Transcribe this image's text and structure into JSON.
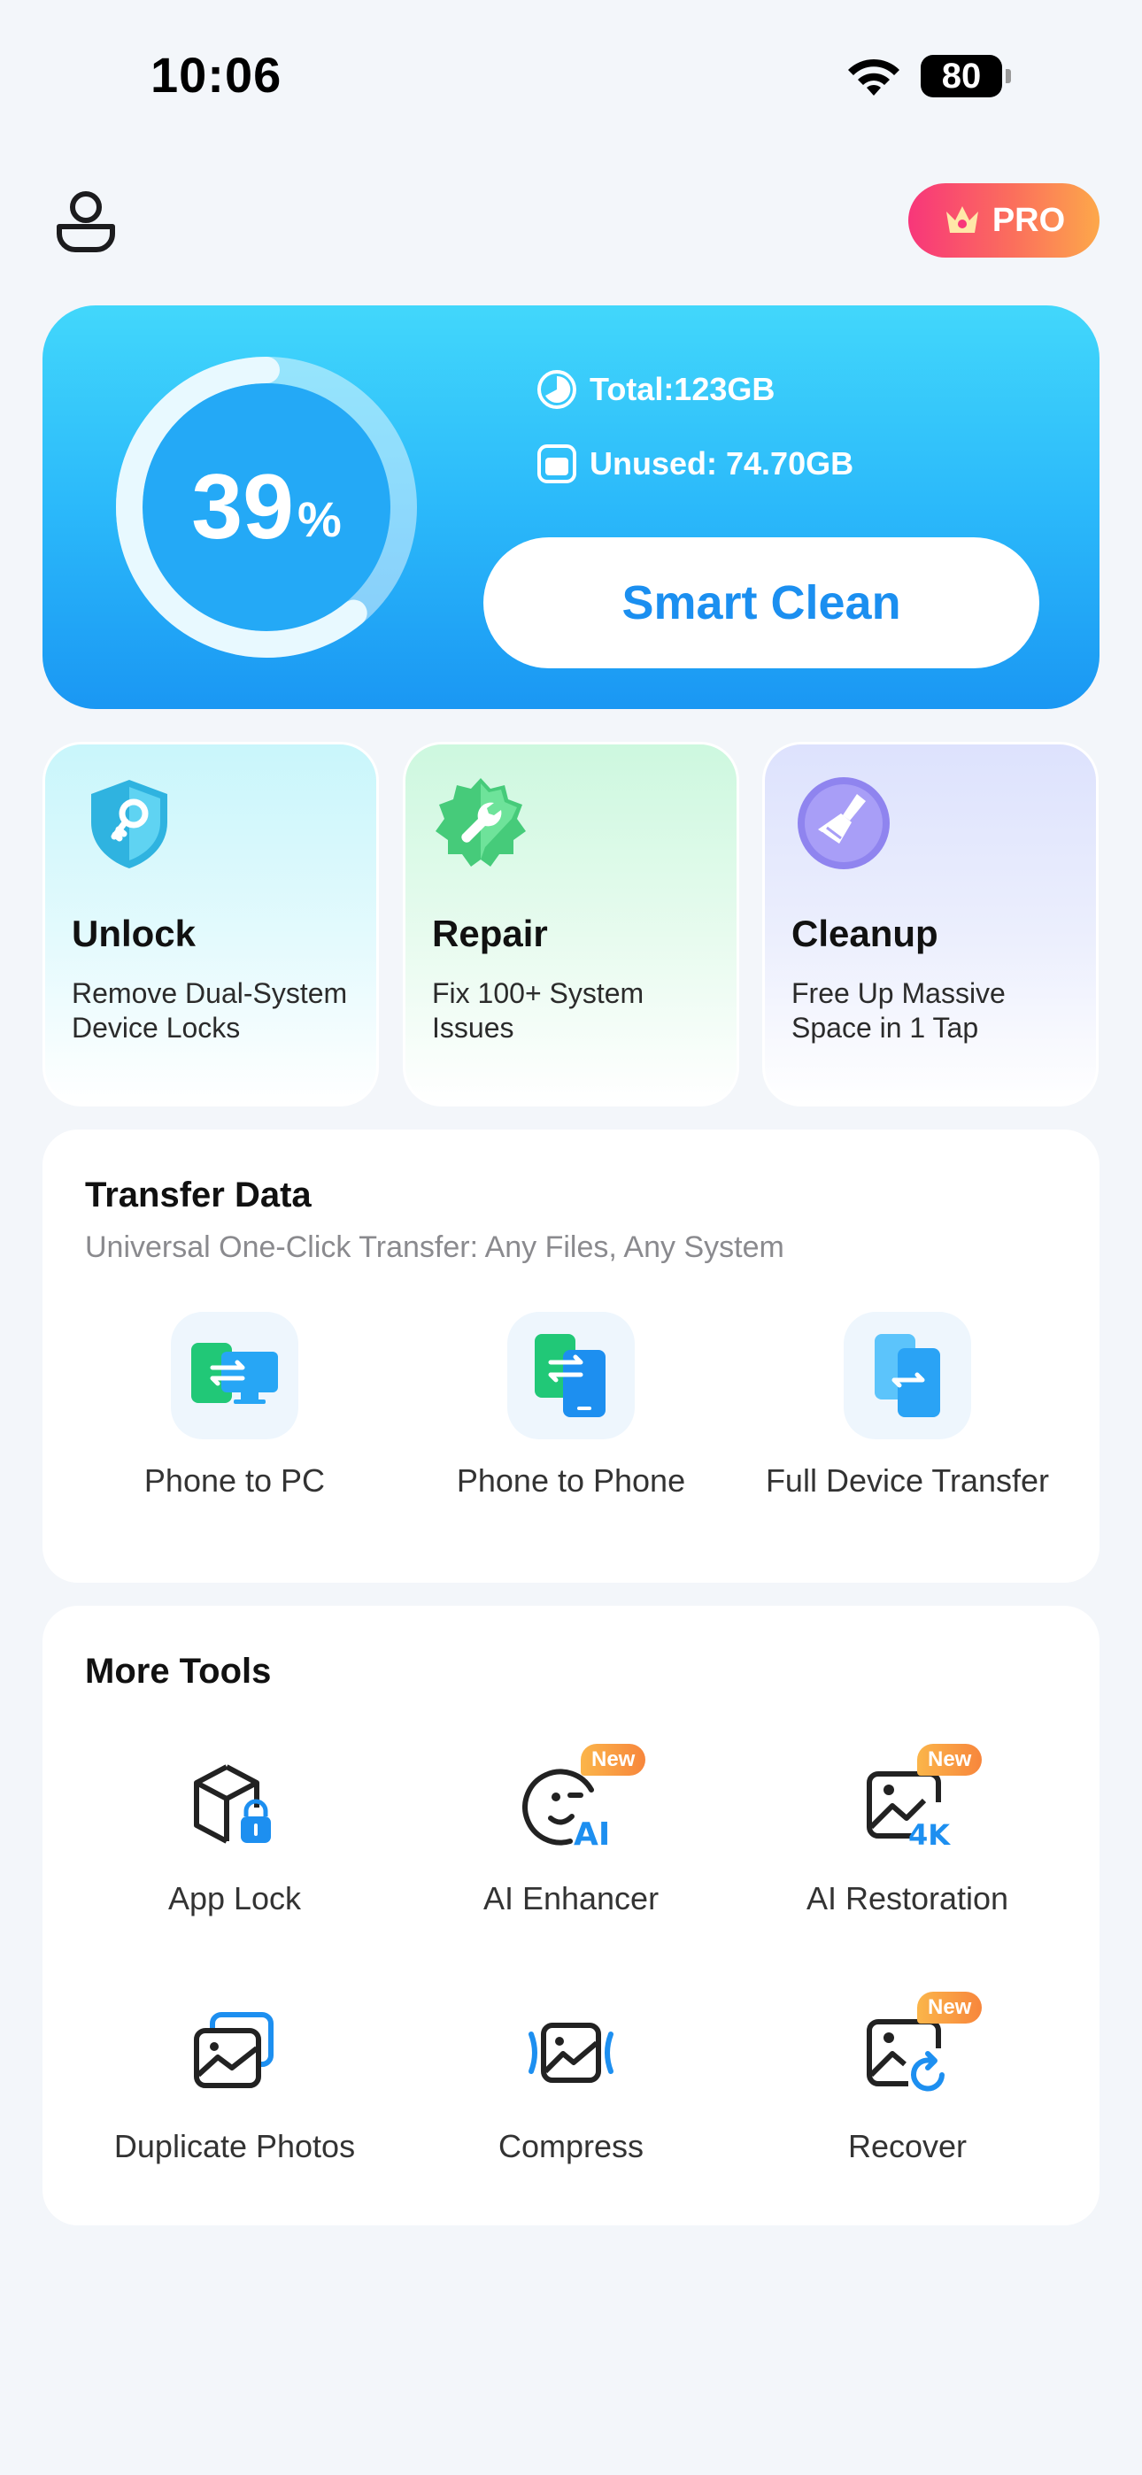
{
  "status_bar": {
    "time": "10:06",
    "battery": "80"
  },
  "header": {
    "pro_label": "PRO",
    "profile_icon": "user-icon"
  },
  "storage": {
    "used_percent": 39,
    "percent_number": "39",
    "percent_sign": "%",
    "total": "Total:123GB",
    "unused": "Unused:  74.70GB",
    "smart_clean_label": "Smart Clean",
    "accent": "#2bb9fa"
  },
  "features": [
    {
      "title": "Unlock",
      "desc": "Remove Dual-System Device Locks",
      "icon": "shield-key-icon"
    },
    {
      "title": "Repair",
      "desc": "Fix 100+ System Issues",
      "icon": "wrench-gear-icon"
    },
    {
      "title": "Cleanup",
      "desc": "Free Up Massive Space in 1 Tap",
      "icon": "broom-icon"
    }
  ],
  "transfer": {
    "title": "Transfer Data",
    "subtitle": "Universal One-Click Transfer: Any Files, Any System",
    "items": [
      {
        "label": "Phone to PC",
        "icon": "phone-to-pc-icon"
      },
      {
        "label": "Phone to Phone",
        "icon": "phone-to-phone-icon"
      },
      {
        "label": "Full Device Transfer",
        "icon": "full-device-transfer-icon"
      }
    ]
  },
  "tools": {
    "title": "More Tools",
    "new_badge": "New",
    "items": [
      {
        "label": "App Lock",
        "icon": "app-lock-icon",
        "is_new": false
      },
      {
        "label": "AI Enhancer",
        "icon": "ai-enhancer-icon",
        "is_new": true
      },
      {
        "label": "AI Restoration",
        "icon": "ai-restoration-icon",
        "is_new": true
      },
      {
        "label": "Duplicate Photos",
        "icon": "duplicate-photos-icon",
        "is_new": false
      },
      {
        "label": "Compress",
        "icon": "compress-icon",
        "is_new": false
      },
      {
        "label": "Recover",
        "icon": "recover-icon",
        "is_new": true
      }
    ]
  }
}
